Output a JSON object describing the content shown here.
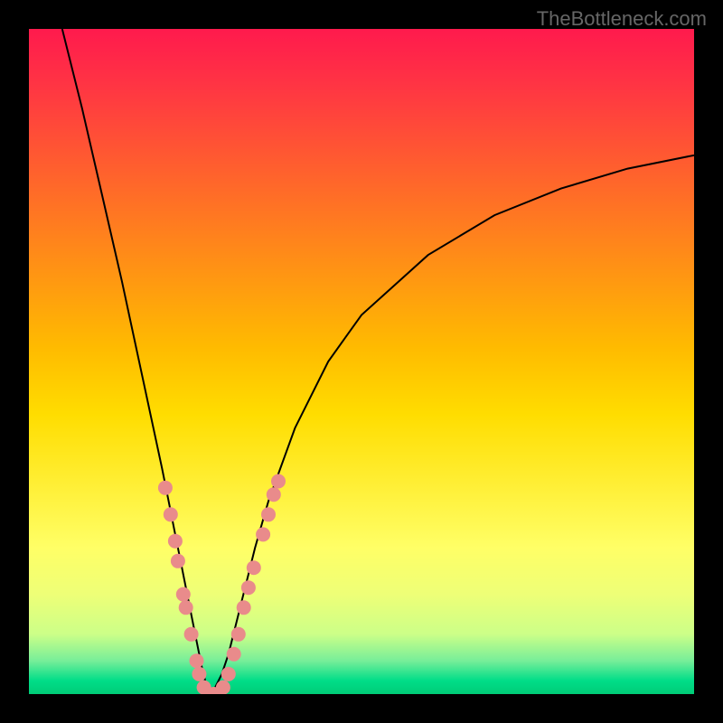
{
  "watermark": "TheBottleneck.com",
  "chart_data": {
    "type": "line",
    "title": "",
    "xlabel": "",
    "ylabel": "",
    "xlim": [
      0,
      100
    ],
    "ylim": [
      0,
      100
    ],
    "grid": false,
    "background_gradient": {
      "top": "#ff1a4d",
      "middle": "#ffdd00",
      "bottom": "#00cc77"
    },
    "curve": {
      "description": "V-shaped bottleneck curve, minimum near x≈27",
      "color": "#000000",
      "width": 2,
      "x": [
        5,
        8,
        11,
        14,
        17,
        20,
        21,
        22,
        23,
        24,
        25,
        26,
        27,
        28,
        29,
        30,
        31,
        32,
        33,
        34,
        36,
        40,
        45,
        50,
        60,
        70,
        80,
        90,
        100
      ],
      "y": [
        100,
        88,
        75,
        62,
        48,
        34,
        29,
        24,
        19,
        14,
        9,
        4,
        0,
        1,
        3,
        6,
        10,
        14,
        18,
        22,
        29,
        40,
        50,
        57,
        66,
        72,
        76,
        79,
        81
      ]
    },
    "markers": {
      "color": "#e98b8b",
      "radius": 8,
      "points": [
        {
          "x": 20.5,
          "y": 31
        },
        {
          "x": 21.3,
          "y": 27
        },
        {
          "x": 22.0,
          "y": 23
        },
        {
          "x": 22.4,
          "y": 20
        },
        {
          "x": 23.2,
          "y": 15
        },
        {
          "x": 23.6,
          "y": 13
        },
        {
          "x": 24.4,
          "y": 9
        },
        {
          "x": 25.2,
          "y": 5
        },
        {
          "x": 25.6,
          "y": 3
        },
        {
          "x": 26.3,
          "y": 1
        },
        {
          "x": 27.0,
          "y": 0
        },
        {
          "x": 27.8,
          "y": 0
        },
        {
          "x": 28.5,
          "y": 0
        },
        {
          "x": 29.2,
          "y": 1
        },
        {
          "x": 30.0,
          "y": 3
        },
        {
          "x": 30.8,
          "y": 6
        },
        {
          "x": 31.5,
          "y": 9
        },
        {
          "x": 32.3,
          "y": 13
        },
        {
          "x": 33.0,
          "y": 16
        },
        {
          "x": 33.8,
          "y": 19
        },
        {
          "x": 35.2,
          "y": 24
        },
        {
          "x": 36.0,
          "y": 27
        },
        {
          "x": 36.8,
          "y": 30
        },
        {
          "x": 37.5,
          "y": 32
        }
      ]
    }
  }
}
